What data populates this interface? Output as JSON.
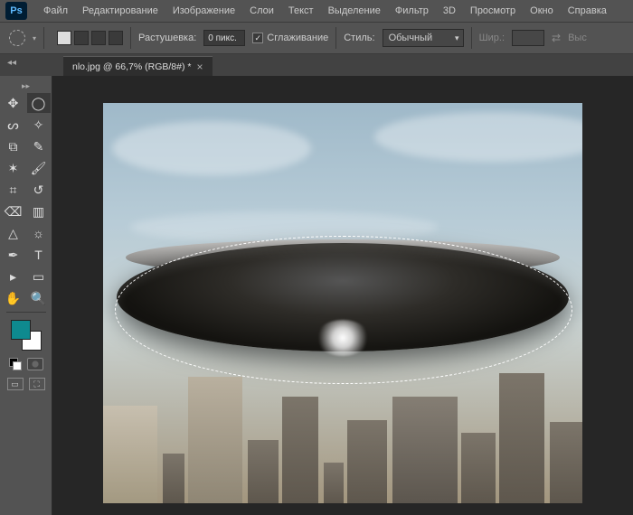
{
  "menubar": {
    "items": [
      "Файл",
      "Редактирование",
      "Изображение",
      "Слои",
      "Текст",
      "Выделение",
      "Фильтр",
      "3D",
      "Просмотр",
      "Окно",
      "Справка"
    ]
  },
  "optbar": {
    "feather_label": "Растушевка:",
    "feather_value": "0 пикс.",
    "antialias_label": "Сглаживание",
    "antialias_checked": true,
    "style_label": "Стиль:",
    "style_value": "Обычный",
    "width_label": "Шир.:",
    "height_label": "Выс"
  },
  "tab": {
    "title": "nlo.jpg @ 66,7% (RGB/8#) *"
  },
  "swatches": {
    "fg": "#0e8a8f",
    "bg": "#ffffff"
  },
  "tools": {
    "names": [
      "move-tool",
      "marquee-tool",
      "lasso-tool",
      "magic-wand-tool",
      "crop-tool",
      "eyedropper-tool",
      "spot-heal-tool",
      "brush-tool",
      "clone-stamp-tool",
      "history-brush-tool",
      "eraser-tool",
      "gradient-tool",
      "blur-tool",
      "dodge-tool",
      "pen-tool",
      "type-tool",
      "path-select-tool",
      "rectangle-tool",
      "hand-tool",
      "zoom-tool"
    ]
  }
}
